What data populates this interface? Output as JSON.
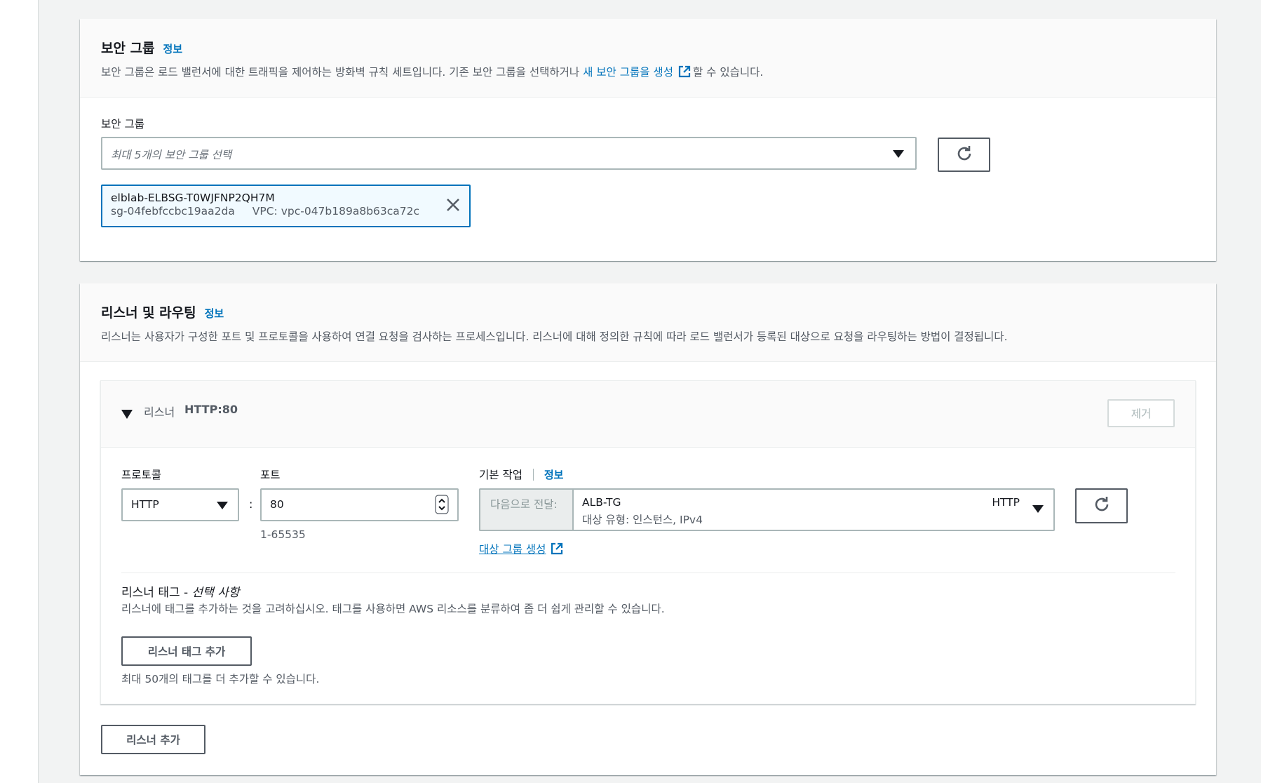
{
  "security_group": {
    "title": "보안 그룹",
    "info": "정보",
    "desc_before": "보안 그룹은 로드 밸런서에 대한 트래픽을 제어하는 방화벽 규칙 세트입니다. 기존 보안 그룹을 선택하거나 ",
    "desc_link": "새 보안 그룹을 생성",
    "desc_after": "할 수 있습니다.",
    "field_label": "보안 그룹",
    "select_placeholder": "최대 5개의 보안 그룹 선택",
    "selected": {
      "name": "elblab-ELBSG-T0WJFNP2QH7M",
      "id": "sg-04febfccbc19aa2da",
      "vpc": "VPC: vpc-047b189a8b63ca72c"
    }
  },
  "listeners": {
    "title": "리스너 및 라우팅",
    "info": "정보",
    "desc": "리스너는 사용자가 구성한 포트 및 프로토콜을 사용하여 연결 요청을 검사하는 프로세스입니다. 리스너에 대해 정의한 규칙에 따라 로드 밸런서가 등록된 대상으로 요청을 라우팅하는 방법이 결정됩니다.",
    "listener": {
      "label": "리스너",
      "name": "HTTP:80",
      "remove_button": "제거",
      "protocol_label": "프로토콜",
      "protocol_value": "HTTP",
      "port_label": "포트",
      "port_value": "80",
      "port_hint": "1-65535",
      "separator": ":",
      "default_action_label": "기본 작업",
      "default_action_info": "정보",
      "forward_prefix": "다음으로 전달:",
      "target_group_name": "ALB-TG",
      "target_group_type": "대상 유형: 인스턴스, IPv4",
      "target_group_protocol": "HTTP",
      "create_target_group_link": "대상 그룹 생성",
      "tags_title": "리스너 태그 - ",
      "tags_optional": "선택 사항",
      "tags_desc": "리스너에 태그를 추가하는 것을 고려하십시오. 태그를 사용하면 AWS 리소스를 분류하여 좀 더 쉽게 관리할 수 있습니다.",
      "add_tag_button": "리스너 태그 추가",
      "tag_limit_note": "최대 50개의 태그를 더 추가할 수 있습니다."
    },
    "add_listener_button": "리스너 추가"
  },
  "icons": {
    "refresh": "refresh-icon",
    "external_link": "external-link-icon",
    "close": "close-icon",
    "caret_down": "caret-down-icon",
    "expand": "expand-triangle-icon",
    "stepper": "stepper-icon"
  },
  "colors": {
    "link": "#0073bb",
    "background": "#f2f3f3",
    "border": "#aab7b8"
  }
}
